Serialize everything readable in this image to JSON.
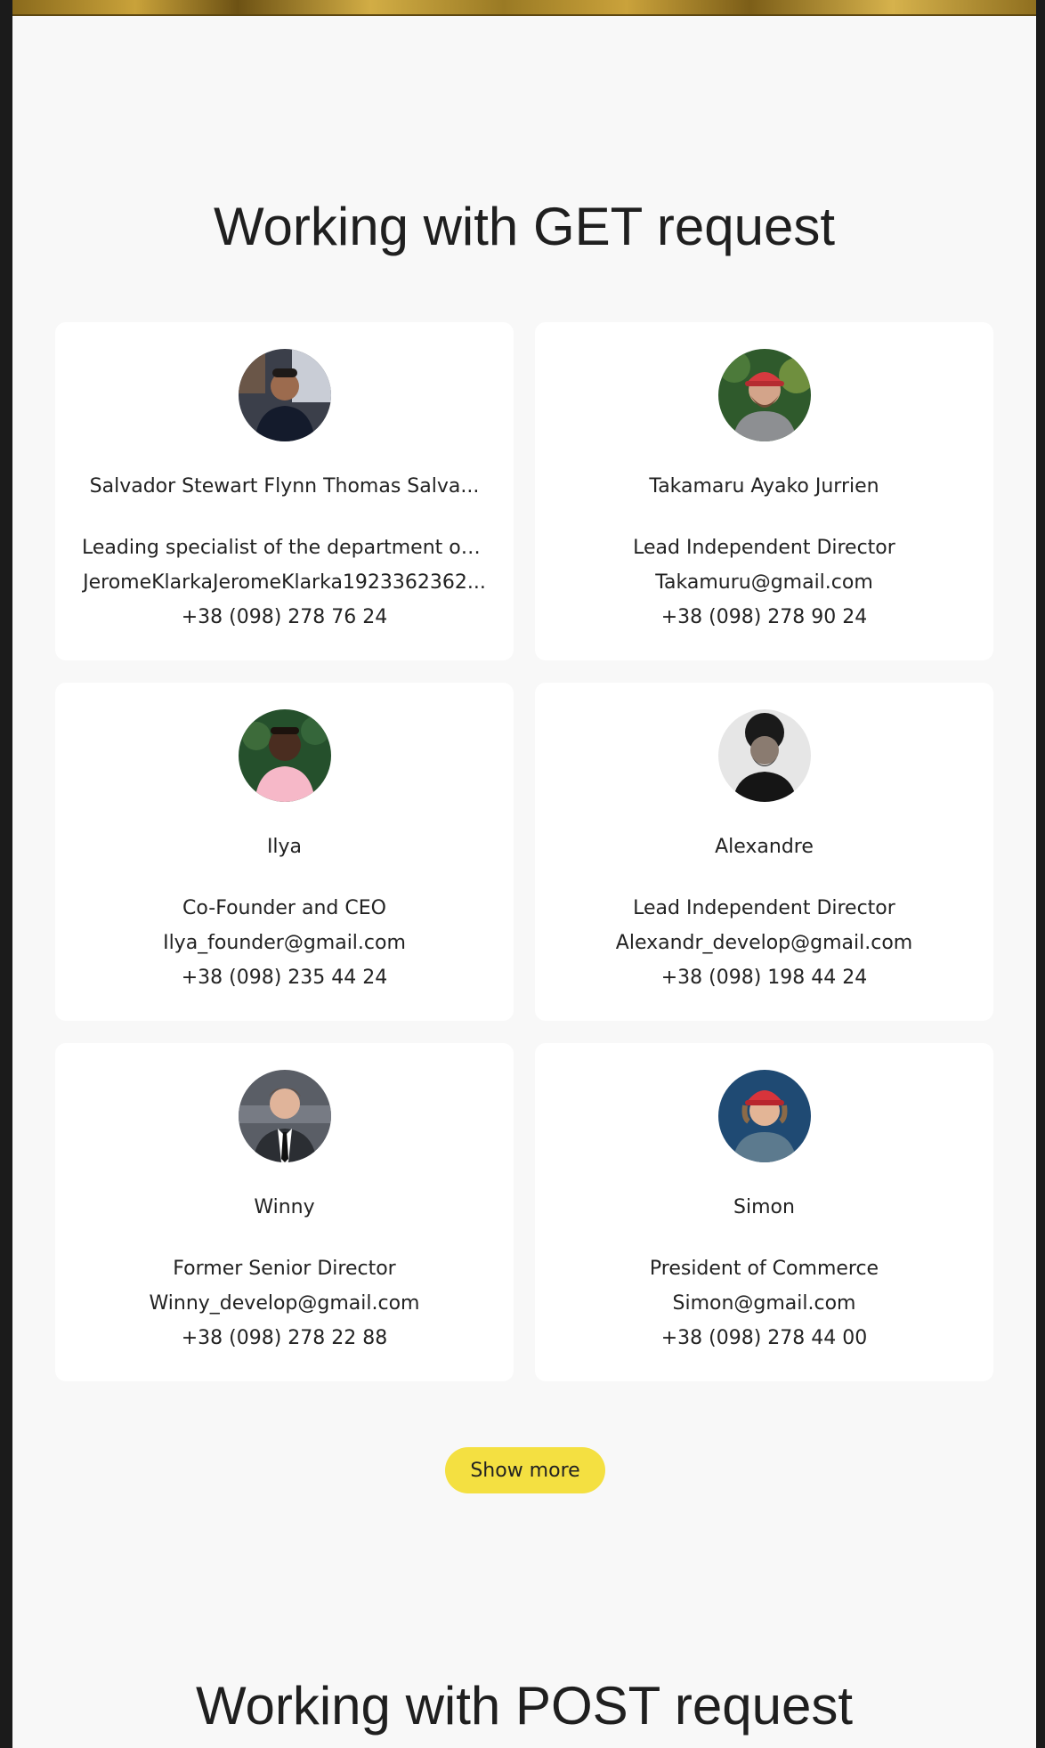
{
  "get_section": {
    "title": "Working with GET request",
    "users": [
      {
        "name": "Salvador Stewart Flynn Thomas Salva...",
        "position": "Leading specialist of the department of c...",
        "email": "JeromeKlarkaJeromeKlarka1923362362...",
        "phone": "+38 (098) 278 76 24"
      },
      {
        "name": "Takamaru Ayako Jurrien",
        "position": "Lead Independent Director",
        "email": "Takamuru@gmail.com",
        "phone": "+38 (098) 278 90 24"
      },
      {
        "name": "Ilya",
        "position": "Co-Founder and CEO",
        "email": "Ilya_founder@gmail.com",
        "phone": "+38 (098) 235 44 24"
      },
      {
        "name": "Alexandre",
        "position": "Lead Independent Director",
        "email": "Alexandr_develop@gmail.com",
        "phone": "+38 (098) 198 44 24"
      },
      {
        "name": "Winny",
        "position": "Former Senior Director",
        "email": "Winny_develop@gmail.com",
        "phone": "+38 (098) 278 22 88"
      },
      {
        "name": "Simon",
        "position": "President of Commerce",
        "email": "Simon@gmail.com",
        "phone": "+38 (098) 278 44 00"
      }
    ],
    "show_more_label": "Show more"
  },
  "post_section": {
    "title": "Working with POST request"
  },
  "colors": {
    "page_background": "#f8f8f8",
    "card_background": "#ffffff",
    "button_primary": "#f4e041",
    "text": "#222222"
  }
}
